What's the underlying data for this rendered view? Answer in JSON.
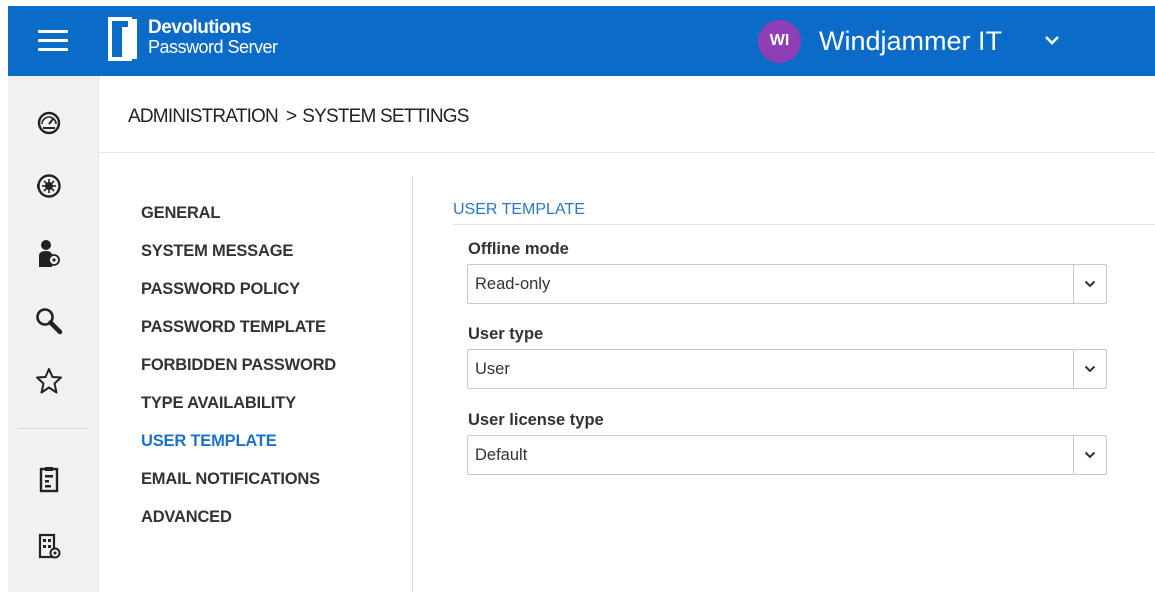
{
  "header": {
    "brand_line1": "Devolutions",
    "brand_line2": "Password Server",
    "user_initials": "WI",
    "org_name": "Windjammer IT",
    "brand_color": "#0b6bc8",
    "avatar_color": "#8e3fb5"
  },
  "nav_icons": [
    "dashboard-icon",
    "vault-icon",
    "user-settings-icon",
    "search-icon",
    "favorites-star-icon",
    "reports-icon",
    "administration-icon"
  ],
  "breadcrumb": {
    "part1": "ADMINISTRATION",
    "separator": ">",
    "part2": "SYSTEM SETTINGS"
  },
  "settings_menu": [
    {
      "label": "GENERAL"
    },
    {
      "label": "SYSTEM MESSAGE"
    },
    {
      "label": "PASSWORD POLICY"
    },
    {
      "label": "PASSWORD TEMPLATE"
    },
    {
      "label": "FORBIDDEN PASSWORD"
    },
    {
      "label": "TYPE AVAILABILITY"
    },
    {
      "label": "USER TEMPLATE",
      "active": true
    },
    {
      "label": "EMAIL NOTIFICATIONS"
    },
    {
      "label": "ADVANCED"
    }
  ],
  "section": {
    "title": "USER TEMPLATE"
  },
  "fields": {
    "offline_mode": {
      "label": "Offline mode",
      "value": "Read-only"
    },
    "user_type": {
      "label": "User type",
      "value": "User"
    },
    "user_license_type": {
      "label": "User license type",
      "value": "Default"
    }
  }
}
